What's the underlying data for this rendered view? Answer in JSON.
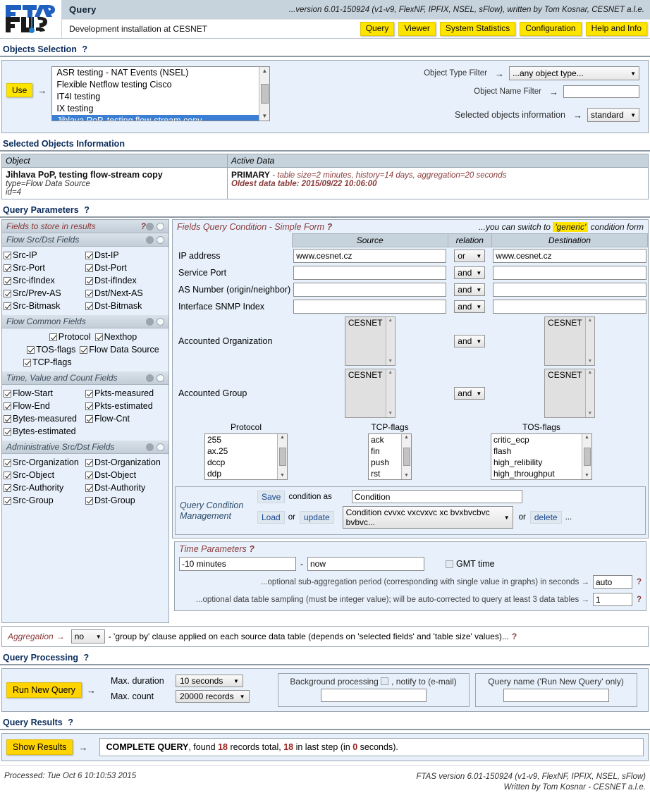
{
  "header": {
    "logo_text": "FTAS",
    "title": "Query",
    "version": "...version 6.01-150924 (v1-v9, FlexNF, IPFIX, NSEL, sFlow), written by Tom Kosnar, CESNET a.l.e.",
    "subtitle": "Development installation at CESNET",
    "nav": [
      {
        "label": "Query"
      },
      {
        "label": "Viewer"
      },
      {
        "label": "System Statistics"
      },
      {
        "label": "Configuration"
      },
      {
        "label": "Help and Info"
      }
    ]
  },
  "objects_selection": {
    "section_title": "Objects Selection",
    "help": "?",
    "use_button": "Use",
    "arrow": "→",
    "list_items": [
      {
        "label": "ASR testing - NAT Events (NSEL)",
        "selected": false
      },
      {
        "label": "Flexible Netflow testing Cisco",
        "selected": false
      },
      {
        "label": "IT4I testing",
        "selected": false
      },
      {
        "label": "IX testing",
        "selected": false
      },
      {
        "label": "Jihlava PoP, testing flow-stream copy",
        "selected": true
      }
    ],
    "object_type_filter_label": "Object Type Filter",
    "object_type_filter_value": "...any object type...",
    "object_name_filter_label": "Object Name Filter",
    "object_name_filter_value": "",
    "selected_objects_information_label": "Selected objects information",
    "selected_objects_information_value": "standard"
  },
  "selected_objects_information": {
    "section_title": "Selected Objects Information",
    "col_object": "Object",
    "col_active_data": "Active Data",
    "object_name": "Jihlava PoP, testing flow-stream copy",
    "object_type": "type=Flow Data Source",
    "object_id": "id=4",
    "active_primary": "PRIMARY",
    "active_detail": "-  table size=2 minutes, history=14 days, aggregation=20 seconds",
    "active_oldest": "Oldest data table: 2015/09/22 10:06:00"
  },
  "query_parameters": {
    "section_title": "Query Parameters",
    "help": "?",
    "fields_panel": {
      "title": "Fields to store in results",
      "help": "?",
      "groups": [
        {
          "title": "Flow Src/Dst Fields",
          "layout": "two-col",
          "items": [
            {
              "label": "Src-IP",
              "checked": true
            },
            {
              "label": "Dst-IP",
              "checked": true
            },
            {
              "label": "Src-Port",
              "checked": true
            },
            {
              "label": "Dst-Port",
              "checked": true
            },
            {
              "label": "Src-ifIndex",
              "checked": true
            },
            {
              "label": "Dst-ifIndex",
              "checked": true
            },
            {
              "label": "Src/Prev-AS",
              "checked": true
            },
            {
              "label": "Dst/Next-AS",
              "checked": true
            },
            {
              "label": "Src-Bitmask",
              "checked": true
            },
            {
              "label": "Dst-Bitmask",
              "checked": true
            }
          ]
        },
        {
          "title": "Flow Common Fields",
          "layout": "center",
          "items": [
            {
              "label": "Protocol",
              "checked": true
            },
            {
              "label": "Nexthop",
              "checked": true
            },
            {
              "label": "TOS-flags",
              "checked": true
            },
            {
              "label": "Flow Data Source",
              "checked": true
            },
            {
              "label": "TCP-flags",
              "checked": true
            }
          ]
        },
        {
          "title": "Time, Value and Count Fields",
          "layout": "two-col",
          "items": [
            {
              "label": "Flow-Start",
              "checked": true
            },
            {
              "label": "Pkts-measured",
              "checked": true
            },
            {
              "label": "Flow-End",
              "checked": true
            },
            {
              "label": "Pkts-estimated",
              "checked": true
            },
            {
              "label": "Bytes-measured",
              "checked": true
            },
            {
              "label": "Flow-Cnt",
              "checked": true
            },
            {
              "label": "Bytes-estimated",
              "checked": true
            }
          ]
        },
        {
          "title": "Administrative Src/Dst Fields",
          "layout": "two-col",
          "items": [
            {
              "label": "Src-Organization",
              "checked": true
            },
            {
              "label": "Dst-Organization",
              "checked": true
            },
            {
              "label": "Src-Object",
              "checked": true
            },
            {
              "label": "Dst-Object",
              "checked": true
            },
            {
              "label": "Src-Authority",
              "checked": true
            },
            {
              "label": "Dst-Authority",
              "checked": true
            },
            {
              "label": "Src-Group",
              "checked": true
            },
            {
              "label": "Dst-Group",
              "checked": true
            }
          ]
        }
      ]
    },
    "condition": {
      "title": "Fields Query Condition - Simple Form",
      "help": "?",
      "switch_prefix": "...you can switch to",
      "switch_link": "'generic'",
      "switch_suffix": "condition form",
      "col_source": "Source",
      "col_relation": "relation",
      "col_destination": "Destination",
      "rows": [
        {
          "label": "IP address",
          "source": "www.cesnet.cz",
          "relation": "or",
          "destination": "www.cesnet.cz"
        },
        {
          "label": "Service Port",
          "source": "",
          "relation": "and",
          "destination": ""
        },
        {
          "label": "AS Number (origin/neighbor)",
          "source": "",
          "relation": "and",
          "destination": ""
        },
        {
          "label": "Interface SNMP Index",
          "source": "",
          "relation": "and",
          "destination": ""
        }
      ],
      "multi_rows": [
        {
          "label": "Accounted Organization",
          "source_options": [
            "CESNET"
          ],
          "relation": "and",
          "destination_options": [
            "CESNET"
          ]
        },
        {
          "label": "Accounted Group",
          "source_options": [
            "CESNET"
          ],
          "relation": "and",
          "destination_options": [
            "CESNET"
          ]
        }
      ],
      "flag_lists": [
        {
          "caption": "Protocol",
          "options": [
            "255",
            "ax.25",
            "dccp",
            "ddp"
          ]
        },
        {
          "caption": "TCP-flags",
          "options": [
            "ack",
            "fin",
            "push",
            "rst"
          ]
        },
        {
          "caption": "TOS-flags",
          "options": [
            "critic_ecp",
            "flash",
            "high_relibility",
            "high_throughput"
          ]
        }
      ],
      "management": {
        "title_line1": "Query Condition",
        "title_line2": "Management",
        "save_label": "Save",
        "save_text": "condition as",
        "save_value": "Condition",
        "load_label": "Load",
        "or_text": "or",
        "update_label": "update",
        "saved_condition": "Condition cvvxc vxcvxvc xc bvxbvcbvc bvbvc...",
        "or_text2": "or",
        "delete_label": "delete",
        "ellipsis": "..."
      }
    },
    "time_parameters": {
      "title": "Time Parameters",
      "help": "?",
      "from": "-10 minutes",
      "dash": "-",
      "to": "now",
      "gmt_label": "GMT time",
      "gmt_checked": false,
      "subagg_text": "...optional sub-aggregation period (corresponding with single value in graphs) in seconds →",
      "subagg_value": "auto",
      "subagg_help": "?",
      "sampling_text": "...optional data table sampling (must be integer value); will be auto-corrected to query at least 3 data tables →",
      "sampling_value": "1",
      "sampling_help": "?"
    },
    "aggregation": {
      "label": "Aggregation",
      "arrow": "→",
      "value": "no",
      "text": "- 'group by' clause applied on each source data table (depends on 'selected fields' and 'table size' values)...",
      "help": "?"
    }
  },
  "query_processing": {
    "section_title": "Query Processing",
    "help": "?",
    "run_button": "Run New Query",
    "arrow": "→",
    "max_duration_label": "Max. duration",
    "max_duration_value": "10 seconds",
    "max_count_label": "Max. count",
    "max_count_value": "20000 records",
    "background_label_pre": "Background processing",
    "background_label_post": ", notify to (e-mail)",
    "background_checked": false,
    "background_value": "",
    "query_name_label": "Query name ('Run New Query' only)",
    "query_name_value": ""
  },
  "query_results": {
    "section_title": "Query Results",
    "help": "?",
    "show_button": "Show Results",
    "arrow": "→",
    "status": "COMPLETE QUERY",
    "text_1": ", found",
    "records_total": "18",
    "text_2": "records total,",
    "records_last_step": "18",
    "text_3": "in last step (in",
    "seconds": "0",
    "text_4": "seconds)."
  },
  "footer": {
    "processed": "Processed: Tue Oct 6 10:10:53 2015",
    "version_line": "FTAS version 6.01-150924 (v1-v9, FlexNF, IPFIX, NSEL, sFlow)",
    "author_line": "Written by Tom Kosnar - CESNET a.l.e."
  },
  "colors": {
    "accent_yellow": "#ffe400",
    "panel_blue": "#e8f1fb",
    "header_blue": "#c6d3dd",
    "selection_blue": "#3b7fd4",
    "title_navy": "#0b2c5c",
    "italic_maroon": "#8a3a3a"
  }
}
